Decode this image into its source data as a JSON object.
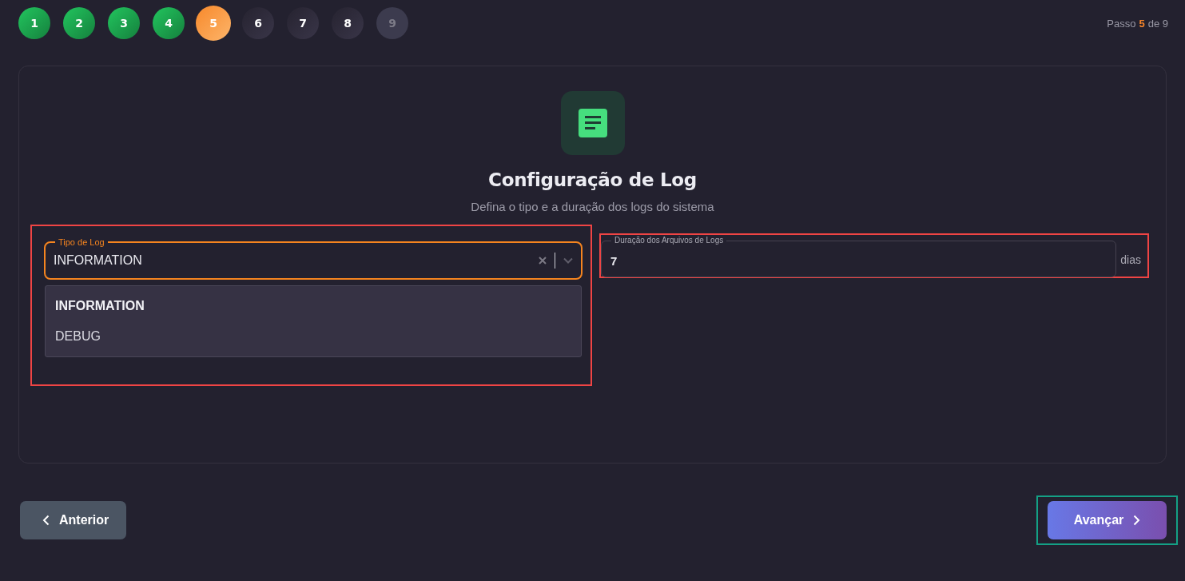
{
  "steps": [
    {
      "label": "1",
      "completed": true,
      "selected": false,
      "disabled": false
    },
    {
      "label": "2",
      "completed": true,
      "selected": false,
      "disabled": false
    },
    {
      "label": "3",
      "completed": true,
      "selected": false,
      "disabled": false
    },
    {
      "label": "4",
      "completed": true,
      "selected": false,
      "disabled": false
    },
    {
      "label": "5",
      "completed": false,
      "selected": true,
      "disabled": false
    },
    {
      "label": "6",
      "completed": false,
      "selected": false,
      "disabled": false
    },
    {
      "label": "7",
      "completed": false,
      "selected": false,
      "disabled": false
    },
    {
      "label": "8",
      "completed": false,
      "selected": false,
      "disabled": false
    },
    {
      "label": "9",
      "completed": false,
      "selected": false,
      "disabled": true
    }
  ],
  "step_counter": {
    "prefix": "Passo",
    "current": "5",
    "suffix": "de 9"
  },
  "card": {
    "title": "Configuração de Log",
    "subtitle": "Defina o tipo e a duração dos logs do sistema",
    "log_type": {
      "label": "Tipo de Log",
      "value": "INFORMATION",
      "focused": true,
      "expanded": true,
      "highlight": {
        "color": "#ef4444"
      },
      "options": [
        {
          "label": "INFORMATION",
          "selected": true
        },
        {
          "label": "DEBUG",
          "selected": false
        }
      ]
    },
    "duration": {
      "label": "Duração dos Arquivos de Logs",
      "value": "7",
      "unit": "dias",
      "highlight": {
        "color": "#ef4444"
      }
    }
  },
  "buttons": [
    {
      "label": "Anterior",
      "kind": "back"
    },
    {
      "label": "Avançar",
      "kind": "next",
      "highlight": {
        "color": "#14a085"
      }
    }
  ]
}
